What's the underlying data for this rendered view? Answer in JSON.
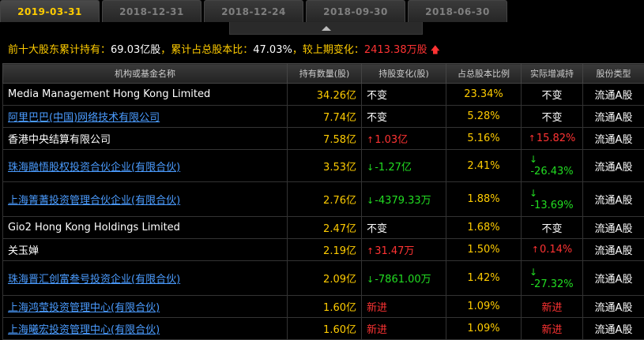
{
  "tabs": [
    "2019-03-31",
    "2018-12-31",
    "2018-12-24",
    "2018-09-30",
    "2018-06-30"
  ],
  "summary": {
    "label1": "前十大股东累计持有：",
    "holding": "69.03亿股",
    "label2": "，累计占总股本比：",
    "ratio": "47.03%",
    "label3": "，较上期变化：",
    "change": "2413.38万股"
  },
  "headers": [
    "机构或基金名称",
    "持有数量(股)",
    "持股变化(股)",
    "占总股本比例",
    "实际增减持",
    "股份类型"
  ],
  "rows": [
    {
      "name": "Media Management Hong Kong Limited",
      "link": false,
      "qty": "34.26亿",
      "chg": "不变",
      "chg_dir": "none",
      "ratio": "23.34%",
      "act": "不变",
      "act_dir": "none",
      "type": "流通A股",
      "h": 28
    },
    {
      "name": "阿里巴巴(中国)网络技术有限公司",
      "link": true,
      "qty": "7.74亿",
      "chg": "不变",
      "chg_dir": "none",
      "ratio": "5.28%",
      "act": "不变",
      "act_dir": "none",
      "type": "流通A股",
      "h": 28
    },
    {
      "name": "香港中央结算有限公司",
      "link": false,
      "qty": "7.58亿",
      "chg": "1.03亿",
      "chg_dir": "up",
      "ratio": "5.16%",
      "act": "15.82%",
      "act_dir": "up",
      "type": "流通A股",
      "h": 28
    },
    {
      "name": "珠海融悟股权投资合伙企业(有限合伙)",
      "link": true,
      "qty": "3.53亿",
      "chg": "-1.27亿",
      "chg_dir": "down",
      "ratio": "2.41%",
      "act": "-26.43%",
      "act_dir": "down",
      "type": "流通A股",
      "h": 41
    },
    {
      "name": "上海箐蓍投资管理合伙企业(有限合伙)",
      "link": true,
      "qty": "2.76亿",
      "chg": "-4379.33万",
      "chg_dir": "down",
      "ratio": "1.88%",
      "act": "-13.69%",
      "act_dir": "down",
      "type": "流通A股",
      "h": 44
    },
    {
      "name": "Gio2 Hong Kong Holdings Limited",
      "link": false,
      "qty": "2.47亿",
      "chg": "不变",
      "chg_dir": "none",
      "ratio": "1.68%",
      "act": "不变",
      "act_dir": "none",
      "type": "流通A股",
      "h": 28
    },
    {
      "name": "关玉婵",
      "link": false,
      "qty": "2.19亿",
      "chg": "31.47万",
      "chg_dir": "up",
      "ratio": "1.50%",
      "act": "0.14%",
      "act_dir": "up",
      "type": "流通A股",
      "h": 28
    },
    {
      "name": "珠海晋汇创富叁号投资企业(有限合伙)",
      "link": true,
      "qty": "2.09亿",
      "chg": "-7861.00万",
      "chg_dir": "down",
      "ratio": "1.42%",
      "act": "-27.32%",
      "act_dir": "down",
      "type": "流通A股",
      "h": 44
    },
    {
      "name": "上海鸿莹投资管理中心(有限合伙)",
      "link": true,
      "qty": "1.60亿",
      "chg": "新进",
      "chg_dir": "new",
      "ratio": "1.09%",
      "act": "新进",
      "act_dir": "new",
      "type": "流通A股",
      "h": 28
    },
    {
      "name": "上海曦宏投资管理中心(有限合伙)",
      "link": true,
      "qty": "1.60亿",
      "chg": "新进",
      "chg_dir": "new",
      "ratio": "1.09%",
      "act": "新进",
      "act_dir": "new",
      "type": "流通A股",
      "h": 28
    }
  ]
}
